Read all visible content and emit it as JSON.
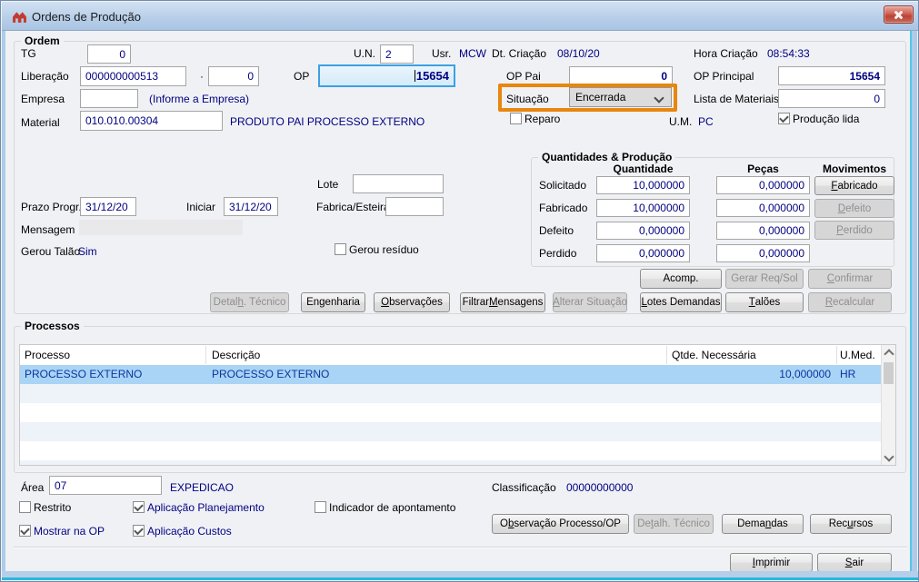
{
  "window": {
    "title": "Ordens de Produção"
  },
  "ordem": {
    "title": "Ordem",
    "fields": {
      "tg_label": "TG",
      "tg_value": "0",
      "un_label": "U.N.",
      "un_value": "2",
      "usr_label": "Usr.",
      "usr_value": "MCW",
      "dt_criacao_label": "Dt. Criação",
      "dt_criacao_value": "08/10/20",
      "hora_criacao_label": "Hora Criação",
      "hora_criacao_value": "08:54:33",
      "liberacao_label": "Liberação",
      "liberacao_value": "000000000513",
      "liberacao_sep": "·",
      "liberacao_seq": "0",
      "op_label": "OP",
      "op_value": "15654",
      "op_pai_label": "OP Pai",
      "op_pai_value": "0",
      "op_principal_label": "OP Principal",
      "op_principal_value": "15654",
      "empresa_label": "Empresa",
      "empresa_value": "",
      "empresa_hint": "(Informe a Empresa)",
      "situacao_label": "Situação",
      "situacao_value": "Encerrada",
      "lista_materiais_label": "Lista de Materiais",
      "lista_materiais_value": "0",
      "reparo_label": "Reparo",
      "material_label": "Material",
      "material_value": "010.010.00304",
      "material_desc": "PRODUTO PAI PROCESSO EXTERNO",
      "um_label": "U.M.",
      "um_value": "PC",
      "producao_lida_label": "Produção lida",
      "lote_label": "Lote",
      "lote_value": "",
      "prazo_label": "Prazo Progr.",
      "prazo_value": "31/12/20",
      "iniciar_label": "Iniciar",
      "iniciar_value": "31/12/20",
      "fabrica_label": "Fabrica/Esteira",
      "fabrica_value": "",
      "mensagem_label": "Mensagem",
      "gerou_talao_label": "Gerou Talão",
      "gerou_talao_value": "Sim",
      "gerou_residuo_label": "Gerou resíduo"
    },
    "checks": {
      "reparo": false,
      "producao_lida": true,
      "gerou_residuo": false
    },
    "buttons_row1": [
      {
        "label": "Acomp.",
        "enabled": true
      },
      {
        "label": "Gerar Req/Sol",
        "enabled": false
      },
      {
        "label": "&Confirmar",
        "enabled": false
      }
    ],
    "buttons_row2": [
      {
        "label": "Detal&h. Técnico",
        "enabled": false
      },
      {
        "label": "En&genharia",
        "enabled": true
      },
      {
        "label": "&Observações",
        "enabled": true
      },
      {
        "label": "Filtrar &Mensagens",
        "enabled": true
      },
      {
        "label": "&Alterar Situação",
        "enabled": false
      },
      {
        "label": "&Lotes Demandas",
        "enabled": true
      },
      {
        "label": "&Talões",
        "enabled": true
      },
      {
        "label": "&Recalcular",
        "enabled": false
      }
    ]
  },
  "quantidades": {
    "title": "Quantidades & Produção",
    "headers": {
      "quantidade": "Quantidade",
      "pecas": "Peças",
      "movimentos": "Movimentos"
    },
    "rows": [
      {
        "label": "Solicitado",
        "quantidade": "10,000000",
        "pecas": "0,000000"
      },
      {
        "label": "Fabricado",
        "quantidade": "10,000000",
        "pecas": "0,000000"
      },
      {
        "label": "Defeito",
        "quantidade": "0,000000",
        "pecas": "0,000000"
      },
      {
        "label": "Perdido",
        "quantidade": "0,000000",
        "pecas": "0,000000"
      }
    ],
    "mov_buttons": [
      {
        "label": "&Fabricado",
        "enabled": true
      },
      {
        "label": "&Defeito",
        "enabled": false
      },
      {
        "label": "&Perdido",
        "enabled": false
      }
    ]
  },
  "processos": {
    "title": "Processos",
    "columns": [
      "Processo",
      "Descrição",
      "Qtde. Necessária",
      "U.Med."
    ],
    "rows": [
      {
        "processo": "PROCESSO EXTERNO",
        "descricao": "PROCESSO EXTERNO",
        "qtde": "10,000000",
        "umed": "HR"
      }
    ],
    "area_label": "Área",
    "area_value": "07",
    "area_desc": "EXPEDICAO",
    "classificacao_label": "Classificação",
    "classificacao_value": "00000000000",
    "checkboxes": [
      {
        "label": "Restrito",
        "checked": false
      },
      {
        "label": "Aplicação Planejamento",
        "checked": true
      },
      {
        "label": "Indicador de apontamento",
        "checked": false
      },
      {
        "label": "Mostrar na OP",
        "checked": true
      },
      {
        "label": "Aplicação Custos",
        "checked": true
      }
    ],
    "buttons": [
      {
        "label": "O&bservação Processo/OP",
        "enabled": true
      },
      {
        "label": "De&talh. Técnico",
        "enabled": false
      },
      {
        "label": "Dema&ndas",
        "enabled": true
      },
      {
        "label": "Rec&ursos",
        "enabled": true
      }
    ]
  },
  "footer_buttons": [
    {
      "label": "&Imprimir",
      "enabled": true
    },
    {
      "label": "&Sair",
      "enabled": true
    }
  ],
  "annotation": {
    "highlight_color": "#e8860d"
  }
}
